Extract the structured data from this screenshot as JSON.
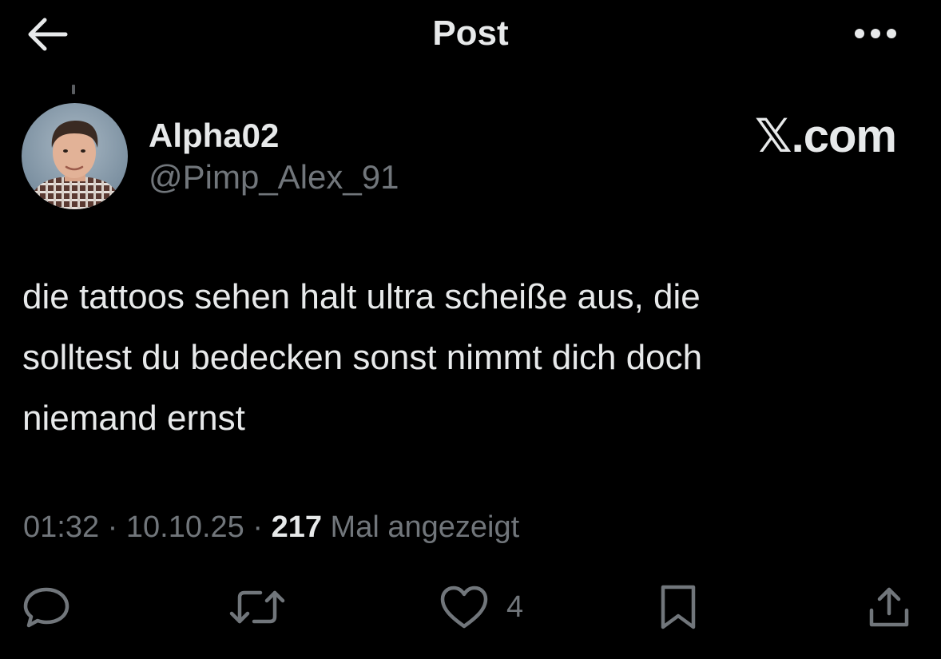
{
  "header": {
    "title": "Post",
    "back_icon": "arrow-left-icon",
    "more_icon": "more-horizontal-icon"
  },
  "author": {
    "display_name": "Alpha02",
    "handle": "@Pimp_Alex_91"
  },
  "watermark": "𝕏.com",
  "post": {
    "lines": [
      "die tattoos sehen halt ultra scheiße aus, die",
      "solltest du bedecken sonst nimmt dich doch",
      "niemand ernst"
    ]
  },
  "meta": {
    "time": "01:32",
    "separator": "·",
    "date": "10.10.25",
    "views_count": "217",
    "views_label": "Mal angezeigt"
  },
  "actions": {
    "reply_icon": "reply-icon",
    "repost_icon": "repost-icon",
    "like_icon": "heart-icon",
    "like_count": "4",
    "bookmark_icon": "bookmark-icon",
    "share_icon": "share-icon"
  },
  "colors": {
    "background": "#000000",
    "text_primary": "#e7e9ea",
    "text_secondary": "#71767b"
  }
}
